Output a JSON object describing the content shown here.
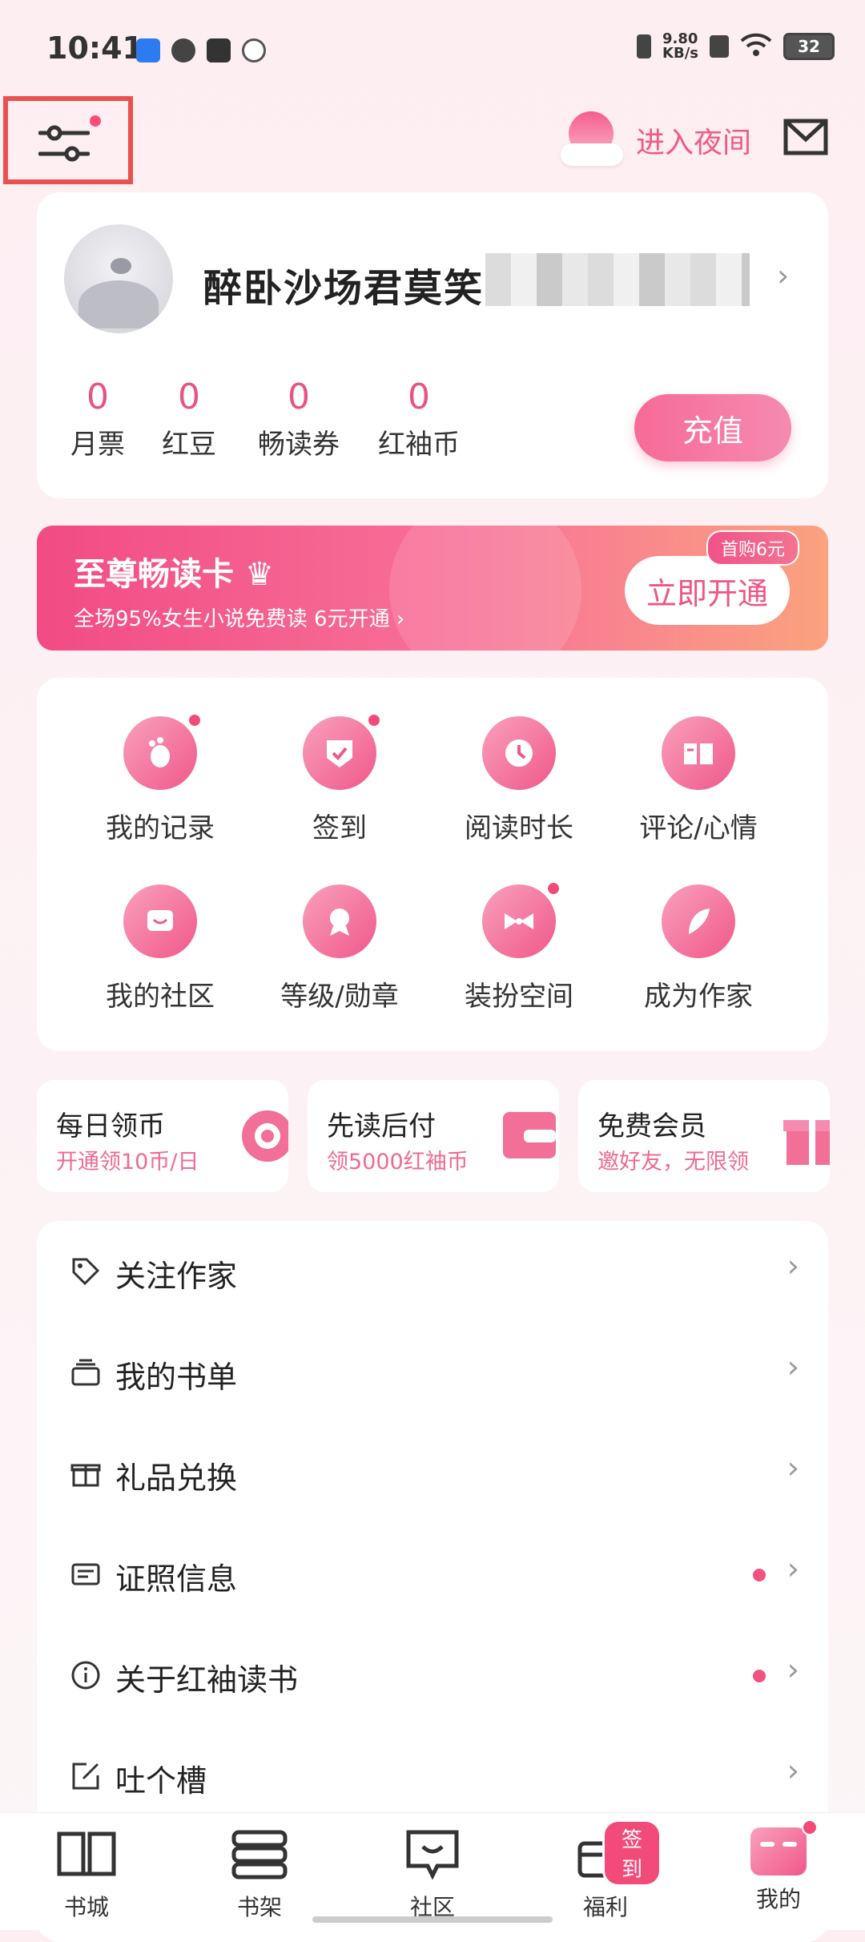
{
  "status": {
    "time": "10:41",
    "net_speed": "9.80\nKB/s",
    "battery": "32"
  },
  "header": {
    "night_label": "进入夜间"
  },
  "profile": {
    "username": "醉卧沙场君莫笑",
    "stats": [
      {
        "value": "0",
        "label": "月票"
      },
      {
        "value": "0",
        "label": "红豆"
      },
      {
        "value": "0",
        "label": "畅读券"
      },
      {
        "value": "0",
        "label": "红袖币"
      }
    ],
    "recharge_label": "充值"
  },
  "vip": {
    "title": "至尊畅读卡",
    "subtitle": "全场95%女生小说免费读 6元开通 ›",
    "button": "立即开通",
    "badge": "首购6元"
  },
  "grid": [
    {
      "label": "我的记录",
      "icon": "footprint-icon",
      "dot": true
    },
    {
      "label": "签到",
      "icon": "checkin-icon",
      "dot": true
    },
    {
      "label": "阅读时长",
      "icon": "clock-icon",
      "dot": false
    },
    {
      "label": "评论/心情",
      "icon": "book-comment-icon",
      "dot": false
    },
    {
      "label": "我的社区",
      "icon": "chat-bubble-icon",
      "dot": false
    },
    {
      "label": "等级/勋章",
      "icon": "medal-icon",
      "dot": false
    },
    {
      "label": "装扮空间",
      "icon": "bowtie-icon",
      "dot": true
    },
    {
      "label": "成为作家",
      "icon": "feather-pen-icon",
      "dot": false
    }
  ],
  "promos": [
    {
      "title": "每日领币",
      "sub": "开通领10币/日"
    },
    {
      "title": "先读后付",
      "sub": "领5000红袖币"
    },
    {
      "title": "免费会员",
      "sub": "邀好友，无限领"
    }
  ],
  "list": [
    {
      "label": "关注作家",
      "dot": false
    },
    {
      "label": "我的书单",
      "dot": false
    },
    {
      "label": "礼品兑换",
      "dot": false
    },
    {
      "label": "证照信息",
      "dot": true
    },
    {
      "label": "关于红袖读书",
      "dot": true
    },
    {
      "label": "吐个槽",
      "dot": false
    }
  ],
  "tabs": [
    {
      "label": "书城"
    },
    {
      "label": "书架"
    },
    {
      "label": "社区"
    },
    {
      "label": "福利",
      "badge": "签到"
    },
    {
      "label": "我的"
    }
  ],
  "colors": {
    "accent": "#ef5584",
    "bg": "#fdeef2"
  }
}
